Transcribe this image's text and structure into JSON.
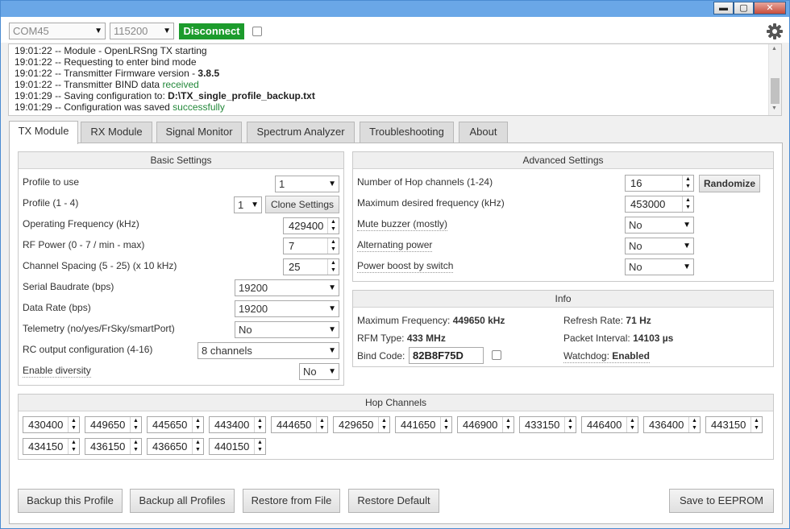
{
  "window": {
    "minimize": "▬",
    "maximize": "▢",
    "close": "✕"
  },
  "toolbar": {
    "port": "COM45",
    "baud": "115200",
    "disconnect_label": "Disconnect",
    "settings_icon": "gear-icon"
  },
  "log": [
    {
      "time": "19:01:22",
      "text": "-- Module - OpenLRSng TX starting",
      "extra": ""
    },
    {
      "time": "19:01:22",
      "text": "-- Requesting to enter bind mode",
      "extra": ""
    },
    {
      "time": "19:01:22",
      "text": "-- Transmitter Firmware version - ",
      "extra": "3.8.5"
    },
    {
      "time": "19:01:22",
      "text": "-- Transmitter BIND data ",
      "extra": "received"
    },
    {
      "time": "19:01:29",
      "text": "-- Saving configuration to: ",
      "extra": "D:\\TX_single_profile_backup.txt"
    },
    {
      "time": "19:01:29",
      "text": "-- Configuration was saved ",
      "extra": "successfully"
    }
  ],
  "tabs": [
    "TX Module",
    "RX Module",
    "Signal Monitor",
    "Spectrum Analyzer",
    "Troubleshooting",
    "About"
  ],
  "basic": {
    "title": "Basic Settings",
    "profile_label": "Profile to use",
    "profile_value": "1",
    "profile_range_label": "Profile (1 - 4)",
    "profile_range_value": "1",
    "clone_label": "Clone Settings",
    "freq_label": "Operating Frequency (kHz)",
    "freq_value": "429400",
    "rf_label": "RF Power (0 - 7 / min - max)",
    "rf_value": "7",
    "spacing_label": "Channel Spacing (5 - 25) (x 10 kHz)",
    "spacing_value": "25",
    "serial_label": "Serial Baudrate (bps)",
    "serial_value": "19200",
    "datarate_label": "Data Rate (bps)",
    "datarate_value": "19200",
    "telemetry_label": "Telemetry (no/yes/FrSky/smartPort)",
    "telemetry_value": "No",
    "rcout_label": "RC output configuration (4-16)",
    "rcout_value": "8 channels",
    "diversity_label": "Enable diversity",
    "diversity_value": "No"
  },
  "advanced": {
    "title": "Advanced Settings",
    "hop_label": "Number of Hop channels (1-24)",
    "hop_value": "16",
    "randomize_label": "Randomize",
    "maxfreq_label": "Maximum desired frequency (kHz)",
    "maxfreq_value": "453000",
    "mute_label": "Mute buzzer (mostly)",
    "mute_value": "No",
    "alt_label": "Alternating power",
    "alt_value": "No",
    "boost_label": "Power boost by switch",
    "boost_value": "No"
  },
  "info": {
    "title": "Info",
    "max_freq_label": "Maximum Frequency:",
    "max_freq_value": "449650 kHz",
    "refresh_label": "Refresh Rate:",
    "refresh_value": "71 Hz",
    "rfm_label": "RFM Type:",
    "rfm_value": "433 MHz",
    "packet_label": "Packet Interval:",
    "packet_value": "14103 µs",
    "bind_label": "Bind Code:",
    "bind_value": "82B8F75D",
    "watchdog_label": "Watchdog:",
    "watchdog_value": "Enabled"
  },
  "hop": {
    "title": "Hop Channels",
    "channels": [
      "430400",
      "449650",
      "445650",
      "443400",
      "444650",
      "429650",
      "441650",
      "446900",
      "433150",
      "446400",
      "436400",
      "443150",
      "434150",
      "436150",
      "436650",
      "440150"
    ]
  },
  "footer": {
    "backup_profile": "Backup this Profile",
    "backup_all": "Backup all Profiles",
    "restore_file": "Restore from File",
    "restore_default": "Restore Default",
    "save_eeprom": "Save to EEPROM"
  }
}
